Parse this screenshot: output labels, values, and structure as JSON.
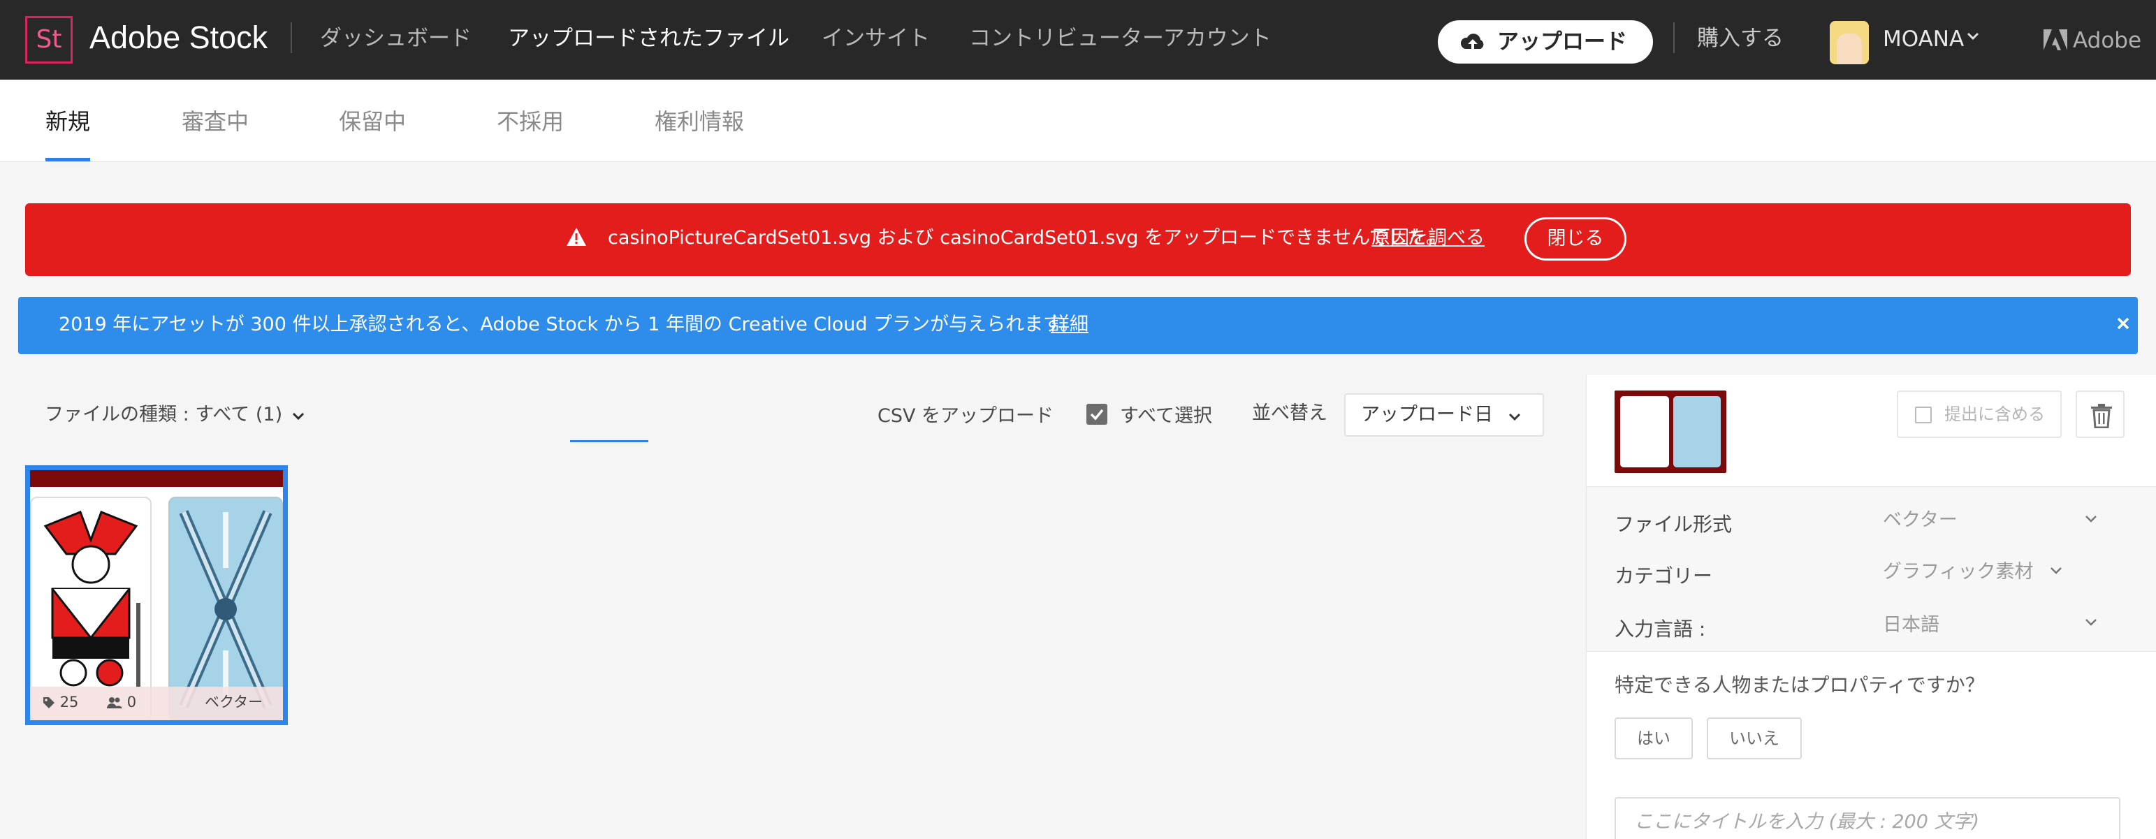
{
  "topnav": {
    "logo_text": "St",
    "brand": "Adobe Stock",
    "links": [
      {
        "label": "ダッシュボード",
        "active": false
      },
      {
        "label": "アップロードされたファイル",
        "active": true
      },
      {
        "label": "インサイト",
        "active": false
      },
      {
        "label": "コントリビューターアカウント",
        "active": false
      }
    ],
    "upload_button": "アップロード",
    "buy_link": "購入する",
    "user_name": "MOANA",
    "adobe_label": "Adobe"
  },
  "subtabs": [
    "新規",
    "審査中",
    "保留中",
    "不採用",
    "権利情報"
  ],
  "alerts": {
    "error": {
      "message": "casinoPictureCardSet01.svg および casinoCardSet01.svg をアップロードできませんでした。",
      "link": "原因を調べる",
      "close": "閉じる"
    },
    "info": {
      "message": "2019 年にアセットが 300 件以上承認されると、Adobe Stock から 1 年間の Creative Cloud プランが与えられます。",
      "link": "詳細"
    }
  },
  "toolbar": {
    "filter": "ファイルの種類 : すべて (1)",
    "csv_upload": "CSV をアップロード",
    "select_all": "すべて選択",
    "sort_label": "並べ替え",
    "sort_value": "アップロード日"
  },
  "thumbnail": {
    "keyword_count": "25",
    "people_count": "0",
    "format": "ベクター"
  },
  "panel": {
    "include_label": "提出に含める",
    "fields": [
      {
        "label": "ファイル形式",
        "value": "ベクター"
      },
      {
        "label": "カテゴリー",
        "value": "グラフィック素材"
      },
      {
        "label": "入力言語 :",
        "value": "日本語"
      }
    ],
    "question": "特定できる人物またはプロパティですか？",
    "yes": "はい",
    "no": "いいえ",
    "title_placeholder": "ここにタイトルを入力 (最大 : 200 文字)"
  },
  "colors": {
    "nav_bg": "#282828",
    "error_bg": "#e31c1c",
    "info_bg": "#2e8cea",
    "accent": "#2d7ff0",
    "logo_accent": "#d7265e"
  }
}
